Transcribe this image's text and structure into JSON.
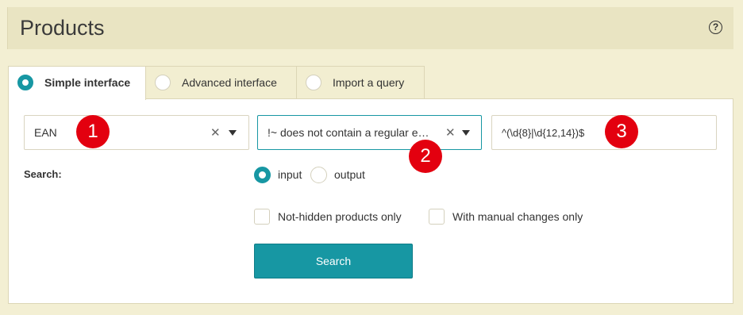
{
  "header": {
    "title": "Products",
    "help_glyph": "?"
  },
  "tabs": [
    {
      "label": "Simple interface",
      "active": true
    },
    {
      "label": "Advanced interface",
      "active": false
    },
    {
      "label": "Import a query",
      "active": false
    }
  ],
  "filter": {
    "field": {
      "value": "EAN",
      "clear_glyph": "✕"
    },
    "operator": {
      "value": "!~  does not contain a regular exp...",
      "clear_glyph": "✕"
    },
    "pattern": {
      "value": "^(\\d{8}|\\d{12,14})$"
    }
  },
  "badges": [
    "1",
    "2",
    "3"
  ],
  "search_section": {
    "label": "Search:",
    "options": [
      {
        "label": "input",
        "checked": true
      },
      {
        "label": "output",
        "checked": false
      }
    ],
    "checkboxes": [
      {
        "label": "Not-hidden products only",
        "checked": false
      },
      {
        "label": "With manual changes only",
        "checked": false
      }
    ],
    "button_label": "Search"
  },
  "colors": {
    "accent": "#1797a3",
    "badge": "#e3000f",
    "background": "#f3efd3"
  }
}
